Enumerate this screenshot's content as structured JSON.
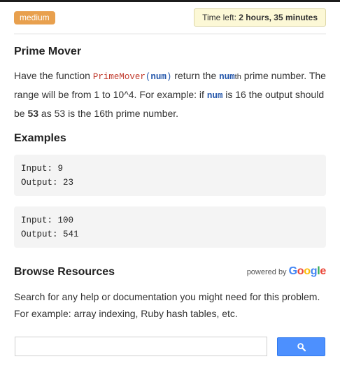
{
  "header": {
    "difficulty": "medium",
    "timer_prefix": "Time left: ",
    "timer_value": "2 hours, 35 minutes"
  },
  "problem": {
    "title": "Prime Mover",
    "desc_1": "Have the function ",
    "function_name": "PrimeMover",
    "paren_open": "(",
    "param": "num",
    "paren_close": ")",
    "desc_2": " return the ",
    "param_2": "num",
    "suffix_th": "th",
    "desc_3": " prime number. The range will be from 1 to 10^4. For example: if ",
    "param_3": "num",
    "desc_4": " is 16 the output should be ",
    "answer": "53",
    "desc_5": " as 53 is the 16th prime number."
  },
  "examples": {
    "title": "Examples",
    "items": [
      {
        "input_label": "Input: ",
        "input": "9",
        "output_label": "Output: ",
        "output": "23"
      },
      {
        "input_label": "Input: ",
        "input": "100",
        "output_label": "Output: ",
        "output": "541"
      }
    ]
  },
  "resources": {
    "title": "Browse Resources",
    "powered_by": "powered by ",
    "google_letters": [
      "G",
      "o",
      "o",
      "g",
      "l",
      "e"
    ],
    "description": "Search for any help or documentation you might need for this problem. For example: array indexing, Ruby hash tables, etc.",
    "search_value": "",
    "search_icon": "search-icon"
  },
  "colors": {
    "badge": "#e8a04e",
    "timer_bg": "#fcf8d6",
    "function_name": "#c0392b",
    "param": "#2255aa",
    "search_button": "#4d90fe"
  }
}
